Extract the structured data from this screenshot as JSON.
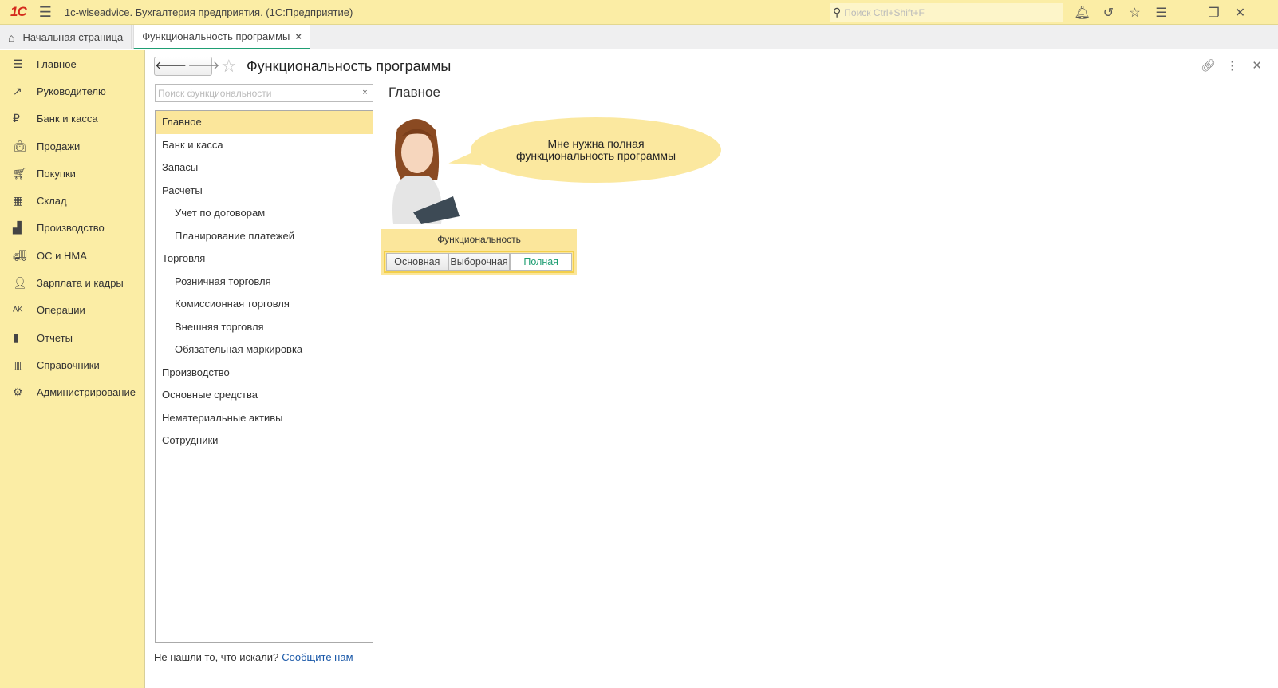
{
  "titlebar": {
    "title": "1c-wiseadvice. Бухгалтерия предприятия.  (1С:Предприятие)",
    "search_placeholder": "Поиск Ctrl+Shift+F"
  },
  "tabs": [
    {
      "label": "Начальная страница"
    },
    {
      "label": "Функциональность программы"
    }
  ],
  "sidebar": {
    "items": [
      {
        "label": "Главное",
        "icon": "menu-icon"
      },
      {
        "label": "Руководителю",
        "icon": "trend-icon"
      },
      {
        "label": "Банк и касса",
        "icon": "ruble-icon"
      },
      {
        "label": "Продажи",
        "icon": "bag-icon"
      },
      {
        "label": "Покупки",
        "icon": "cart-icon"
      },
      {
        "label": "Склад",
        "icon": "warehouse-icon"
      },
      {
        "label": "Производство",
        "icon": "factory-icon"
      },
      {
        "label": "ОС и НМА",
        "icon": "truck-icon"
      },
      {
        "label": "Зарплата и кадры",
        "icon": "person-icon"
      },
      {
        "label": "Операции",
        "icon": "dt-kt-icon"
      },
      {
        "label": "Отчеты",
        "icon": "chart-icon"
      },
      {
        "label": "Справочники",
        "icon": "books-icon"
      },
      {
        "label": "Администрирование",
        "icon": "gear-icon"
      }
    ]
  },
  "page": {
    "title": "Функциональность программы",
    "search_placeholder": "Поиск функциональности",
    "section_title": "Главное",
    "list": [
      {
        "label": "Главное",
        "sub": false
      },
      {
        "label": "Банк и касса",
        "sub": false
      },
      {
        "label": "Запасы",
        "sub": false
      },
      {
        "label": "Расчеты",
        "sub": false
      },
      {
        "label": "Учет по договорам",
        "sub": true
      },
      {
        "label": "Планирование платежей",
        "sub": true
      },
      {
        "label": "Торговля",
        "sub": false
      },
      {
        "label": "Розничная торговля",
        "sub": true
      },
      {
        "label": "Комиссионная торговля",
        "sub": true
      },
      {
        "label": "Внешняя торговля",
        "sub": true
      },
      {
        "label": "Обязательная маркировка",
        "sub": true
      },
      {
        "label": "Производство",
        "sub": false
      },
      {
        "label": "Основные средства",
        "sub": false
      },
      {
        "label": "Нематериальные активы",
        "sub": false
      },
      {
        "label": "Сотрудники",
        "sub": false
      }
    ],
    "bubble_line1": "Мне нужна полная",
    "bubble_line2": "функциональность программы",
    "func_label": "Функциональность",
    "options": [
      "Основная",
      "Выборочная",
      "Полная"
    ],
    "selected": "Полная",
    "footer_text": "Не нашли то, что искали?",
    "footer_link": "Сообщите нам"
  },
  "colors": {
    "accent": "#1f9e73",
    "panel": "#fbeda5"
  }
}
